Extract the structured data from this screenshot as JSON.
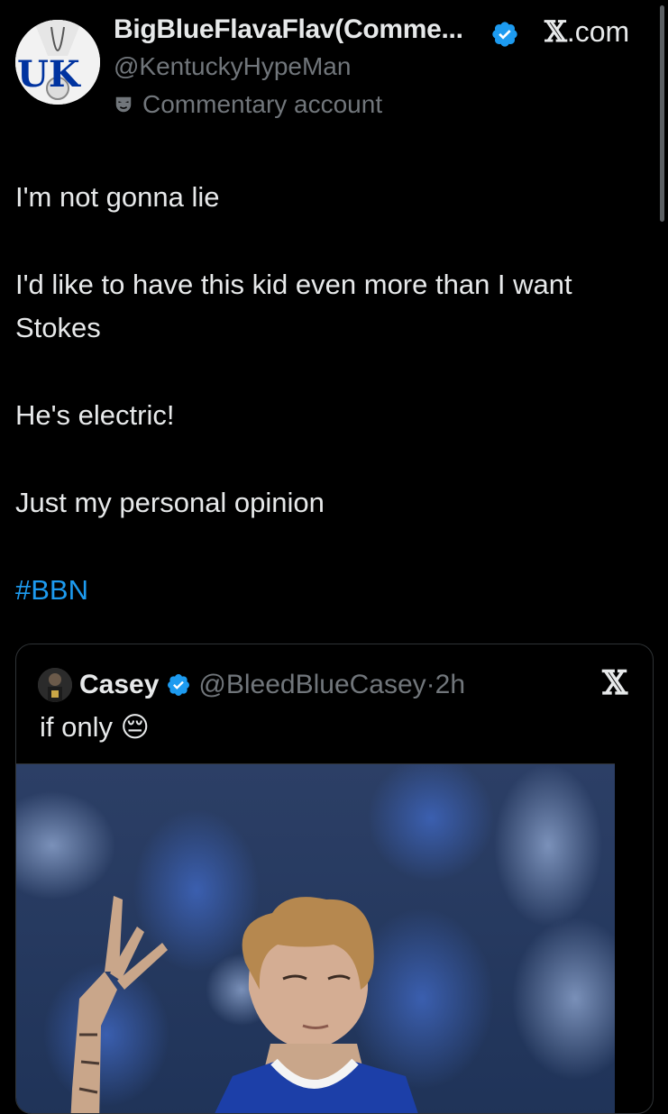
{
  "post": {
    "display_name": "BigBlueFlavaFlav(Comme...",
    "handle": "@KentuckyHypeMan",
    "label": "Commentary account",
    "site": ".com",
    "site_glyph": "𝕏",
    "paragraphs": [
      "I'm not gonna lie",
      "I'd like to have this kid even more than I want Stokes",
      "He's electric!",
      "Just my personal opinion"
    ],
    "hashtag": "#BBN"
  },
  "quote": {
    "name": "Casey",
    "handle": "@BleedBlueCasey",
    "separator": "·",
    "time": "2h",
    "text": "if only",
    "emoji": "😔",
    "x_glyph": "𝕏"
  },
  "colors": {
    "background": "#000000",
    "text": "#e7e9ea",
    "muted": "#71767b",
    "link": "#1d9bf0",
    "verified": "#1d9bf0",
    "kentucky_blue": "#0033a0"
  },
  "icons": [
    "verified-badge-icon",
    "mask-icon",
    "x-logo-icon"
  ]
}
